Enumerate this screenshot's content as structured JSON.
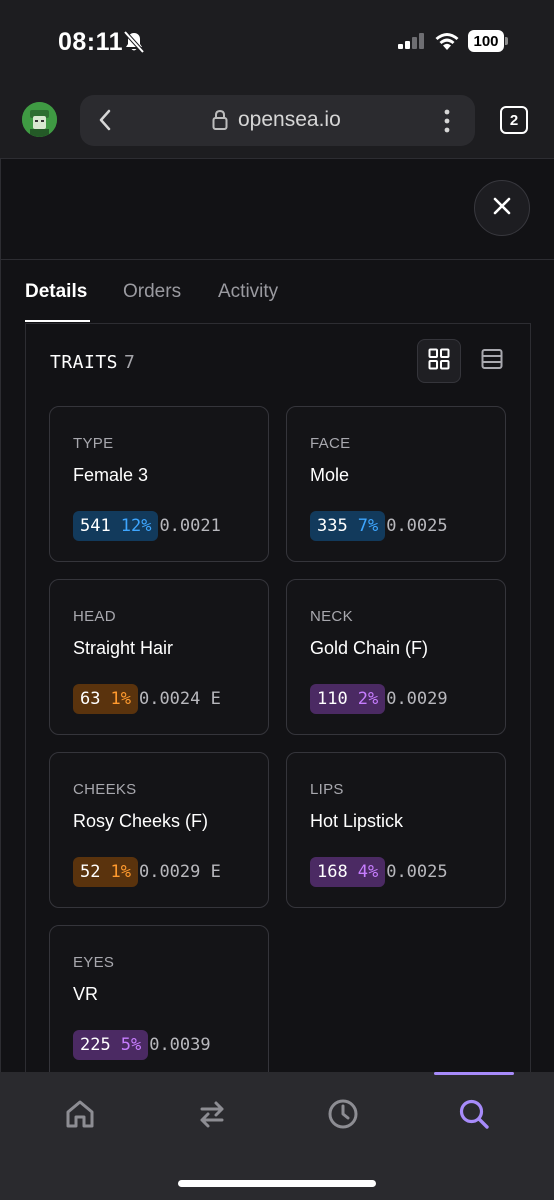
{
  "status_bar": {
    "time": "08:11",
    "battery": "100"
  },
  "browser": {
    "url": "opensea.io",
    "tab_count": "2"
  },
  "tabs": [
    {
      "label": "Details",
      "active": true
    },
    {
      "label": "Orders",
      "active": false
    },
    {
      "label": "Activity",
      "active": false
    }
  ],
  "traits": {
    "title": "TRAITS",
    "count": "7",
    "items": [
      {
        "type": "TYPE",
        "value": "Female 3",
        "count": "541",
        "percent": "12%",
        "price": "0.0021",
        "color": "blue"
      },
      {
        "type": "FACE",
        "value": "Mole",
        "count": "335",
        "percent": "7%",
        "price": "0.0025",
        "color": "blue"
      },
      {
        "type": "HEAD",
        "value": "Straight Hair",
        "count": "63",
        "percent": "1%",
        "price": "0.0024 E",
        "color": "orange"
      },
      {
        "type": "NECK",
        "value": "Gold Chain (F)",
        "count": "110",
        "percent": "2%",
        "price": "0.0029",
        "color": "purple"
      },
      {
        "type": "CHEEKS",
        "value": "Rosy Cheeks (F)",
        "count": "52",
        "percent": "1%",
        "price": "0.0029 E",
        "color": "orange"
      },
      {
        "type": "LIPS",
        "value": "Hot Lipstick",
        "count": "168",
        "percent": "4%",
        "price": "0.0025",
        "color": "purple"
      },
      {
        "type": "EYES",
        "value": "VR",
        "count": "225",
        "percent": "5%",
        "price": "0.0039",
        "color": "purple"
      }
    ]
  },
  "bottom_nav": [
    {
      "icon": "home-icon",
      "active": false
    },
    {
      "icon": "swap-icon",
      "active": false
    },
    {
      "icon": "history-icon",
      "active": false
    },
    {
      "icon": "search-icon",
      "active": true
    }
  ],
  "colors": {
    "accent": "#a78bfa",
    "blue_pct": "#3ea6ff",
    "orange_pct": "#ff9a2e",
    "purple_pct": "#c77dff"
  }
}
